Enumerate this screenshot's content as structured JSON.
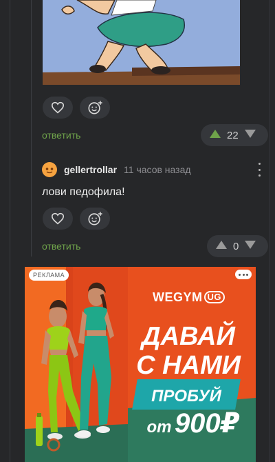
{
  "comment1": {
    "reply_label": "ответить",
    "rating": "22"
  },
  "comment2": {
    "username": "gellertrollar",
    "time": "11 часов назад",
    "text": "лови педофила!",
    "reply_label": "ответить",
    "rating": "0"
  },
  "ad": {
    "label": "РЕКЛАМА",
    "brand": "WEGYM",
    "brand_mark": "UG",
    "headline_line1": "ДАВАЙ",
    "headline_line2": "С НАМИ",
    "cta": "ПРОБУЙ",
    "price_prefix": "от",
    "price": "900₽"
  },
  "colors": {
    "background": "#262729",
    "pill": "#35373b",
    "reply_green": "#6fa34a",
    "upvote_active": "#6fa34a",
    "avatar": "#f6a340",
    "ad_orange": "#e54a1c",
    "ad_teal": "#1ea6a9"
  },
  "icons": [
    "heart-icon",
    "emoji-add-icon",
    "upvote-icon",
    "downvote-icon",
    "more-vertical-icon",
    "more-horizontal-icon",
    "avatar-face-icon"
  ]
}
